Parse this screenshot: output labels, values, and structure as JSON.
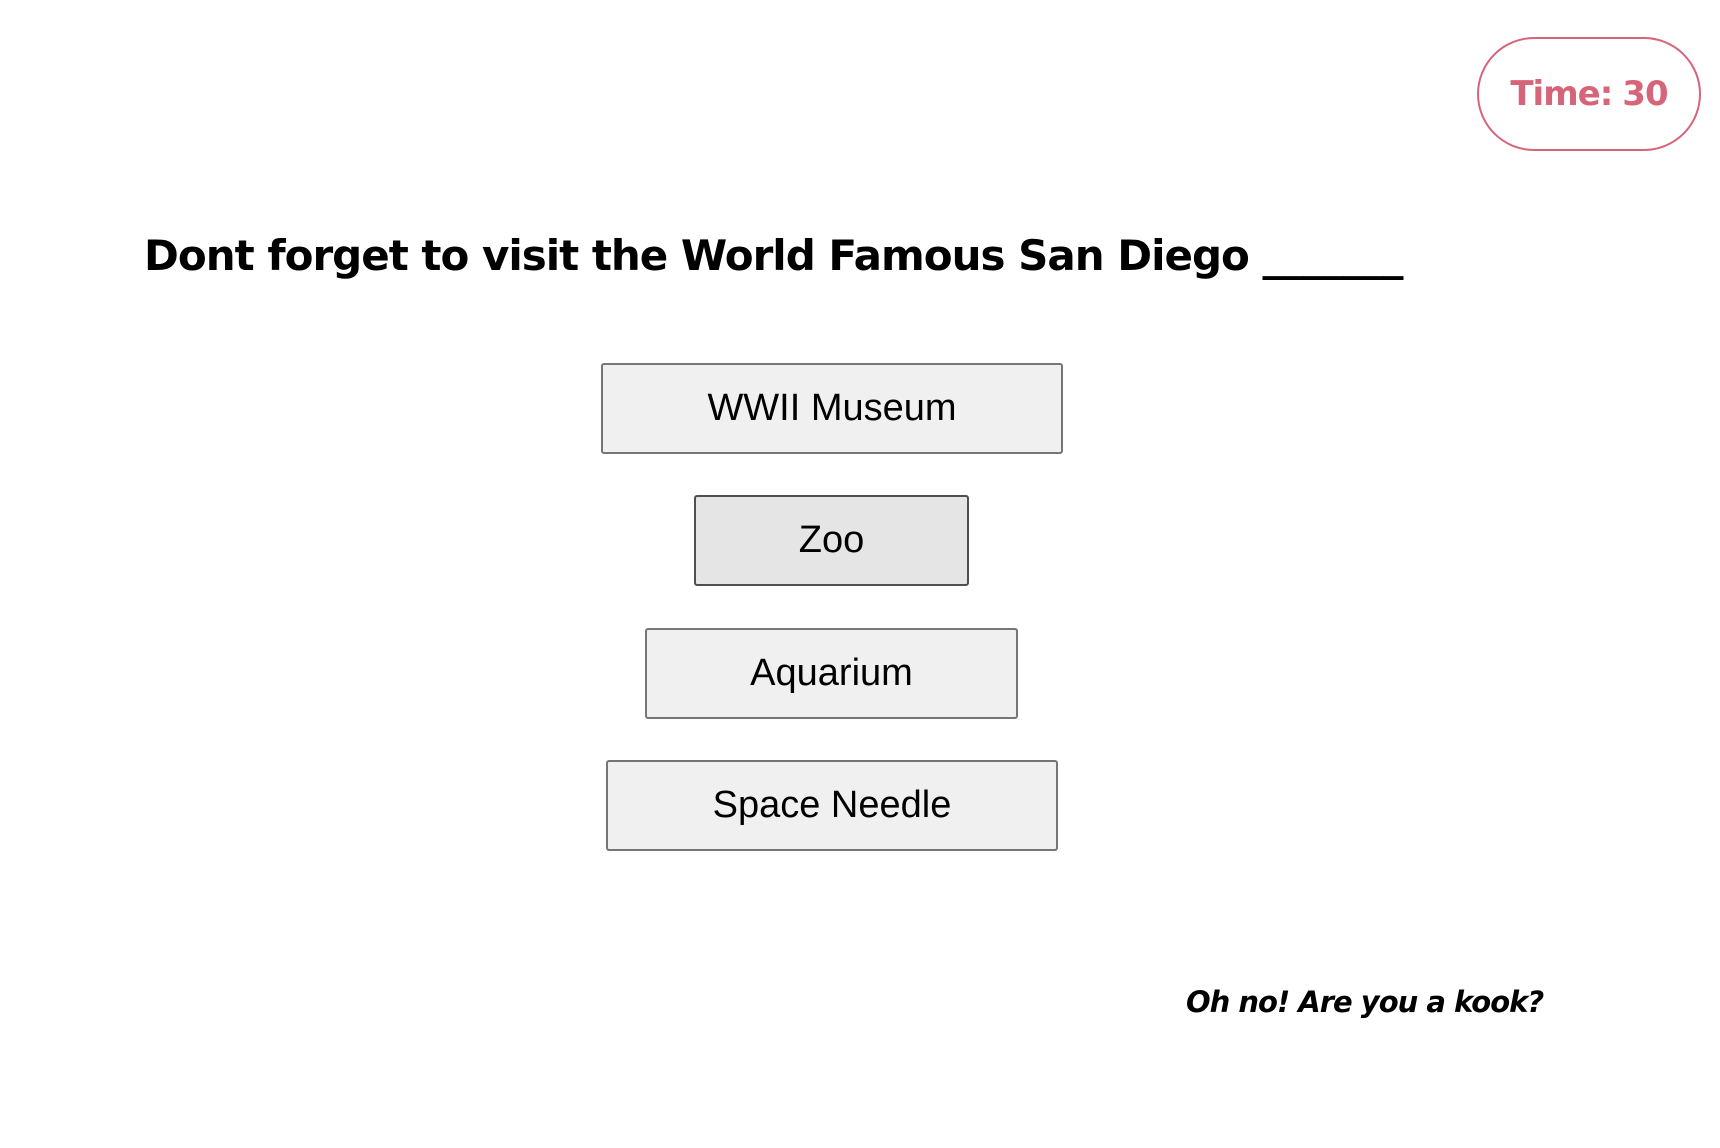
{
  "timer": {
    "label": "Time:",
    "value": "30",
    "color": "#d7657a"
  },
  "question": {
    "text": "Dont forget to visit the World Famous San Diego _______"
  },
  "answers": [
    {
      "label": "WWII Museum"
    },
    {
      "label": "Zoo"
    },
    {
      "label": "Aquarium"
    },
    {
      "label": "Space Needle"
    }
  ],
  "feedback": {
    "text": "Oh no! Are you a kook?"
  }
}
